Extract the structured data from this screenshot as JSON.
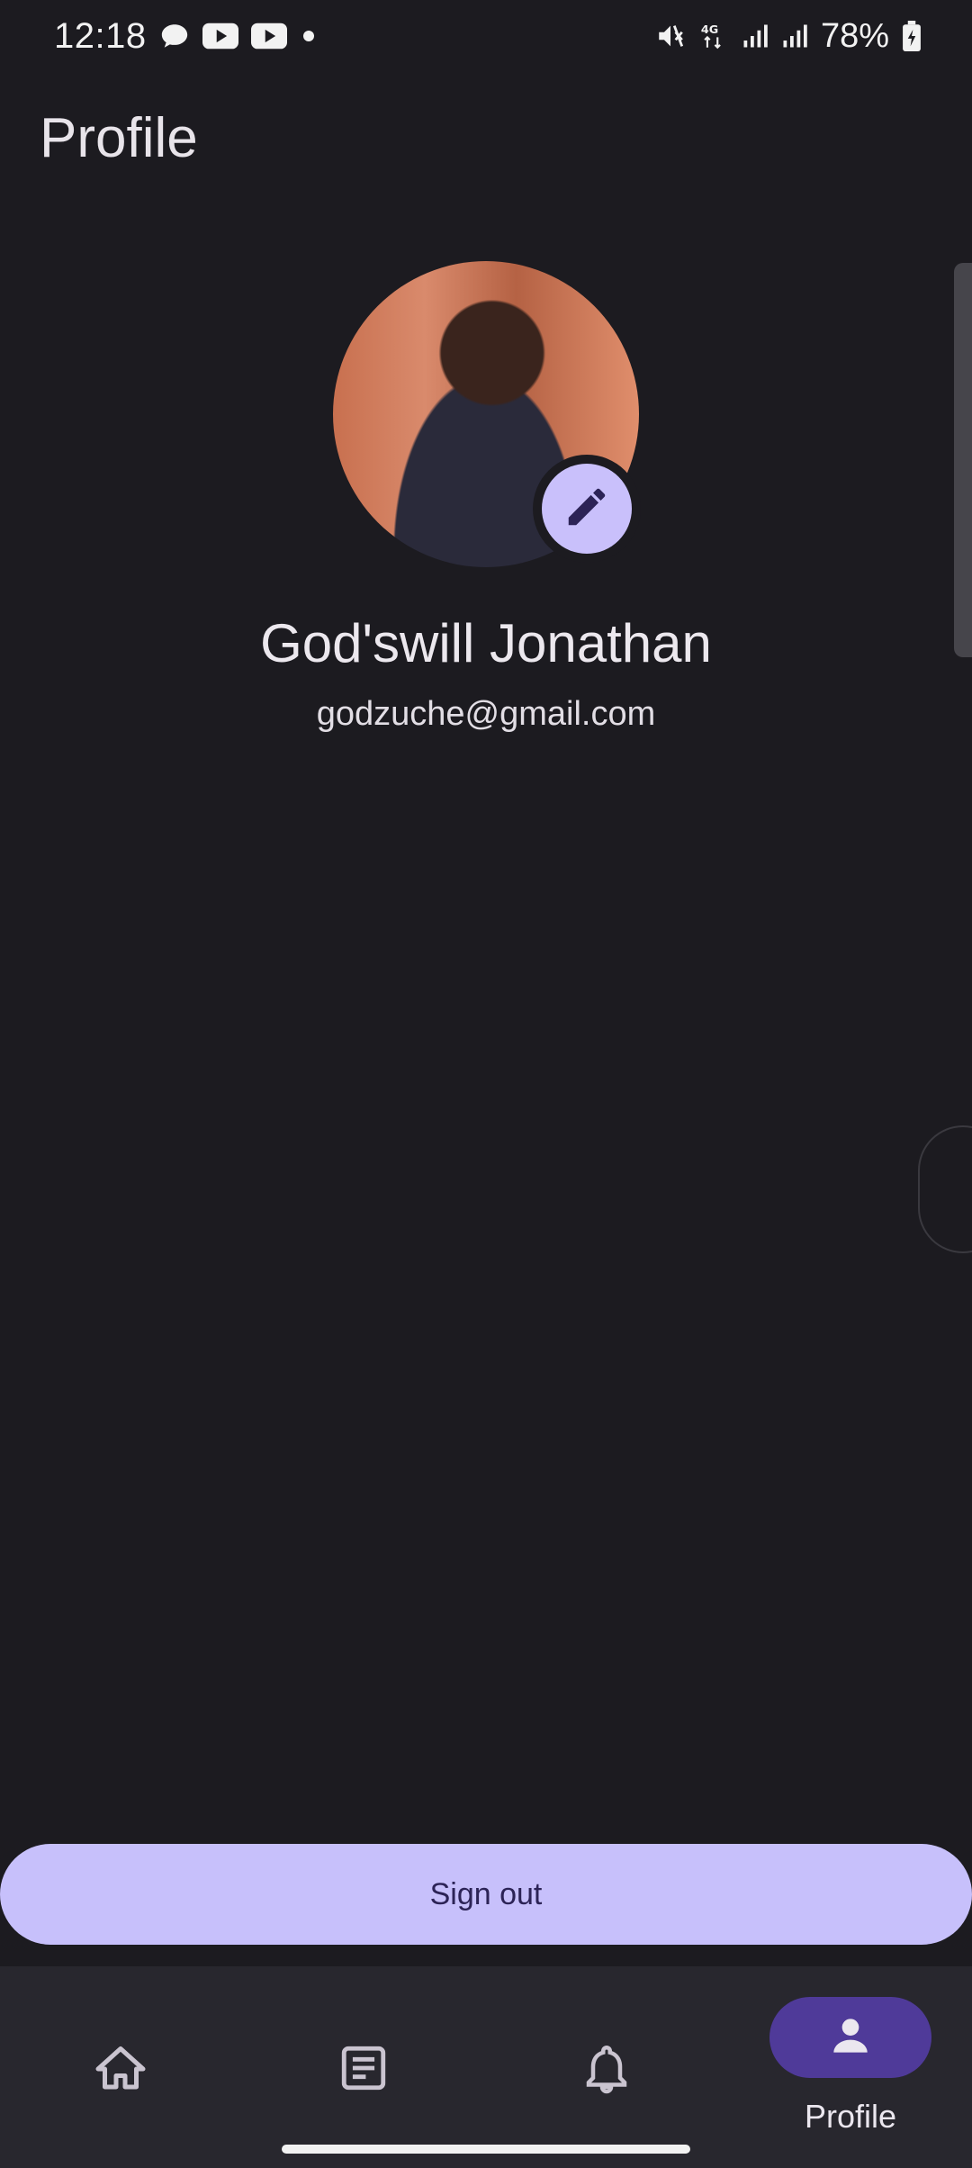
{
  "status_bar": {
    "time": "12:18",
    "battery_pct": "78%",
    "network": "4G",
    "notification_icons": [
      "chat-bubble-icon",
      "youtube-icon",
      "youtube-icon",
      "dot-icon"
    ],
    "system_icons": [
      "mute-icon",
      "4g-icon",
      "signal-icon",
      "signal-icon",
      "battery-charging-icon"
    ]
  },
  "header": {
    "title": "Profile"
  },
  "profile": {
    "name": "God'swill Jonathan",
    "email": "godzuche@gmail.com",
    "avatar_icon": "profile-photo",
    "edit_icon": "pencil-icon"
  },
  "actions": {
    "sign_out_label": "Sign out"
  },
  "bottom_nav": {
    "items": [
      {
        "icon": "home-icon",
        "label": "",
        "selected": false
      },
      {
        "icon": "article-icon",
        "label": "",
        "selected": false
      },
      {
        "icon": "bell-icon",
        "label": "",
        "selected": false
      },
      {
        "icon": "person-icon",
        "label": "Profile",
        "selected": true
      }
    ]
  },
  "colors": {
    "background": "#1c1b20",
    "accent_light": "#c7c0fb",
    "accent_dark": "#4f3a99",
    "nav_background": "#28272e"
  }
}
